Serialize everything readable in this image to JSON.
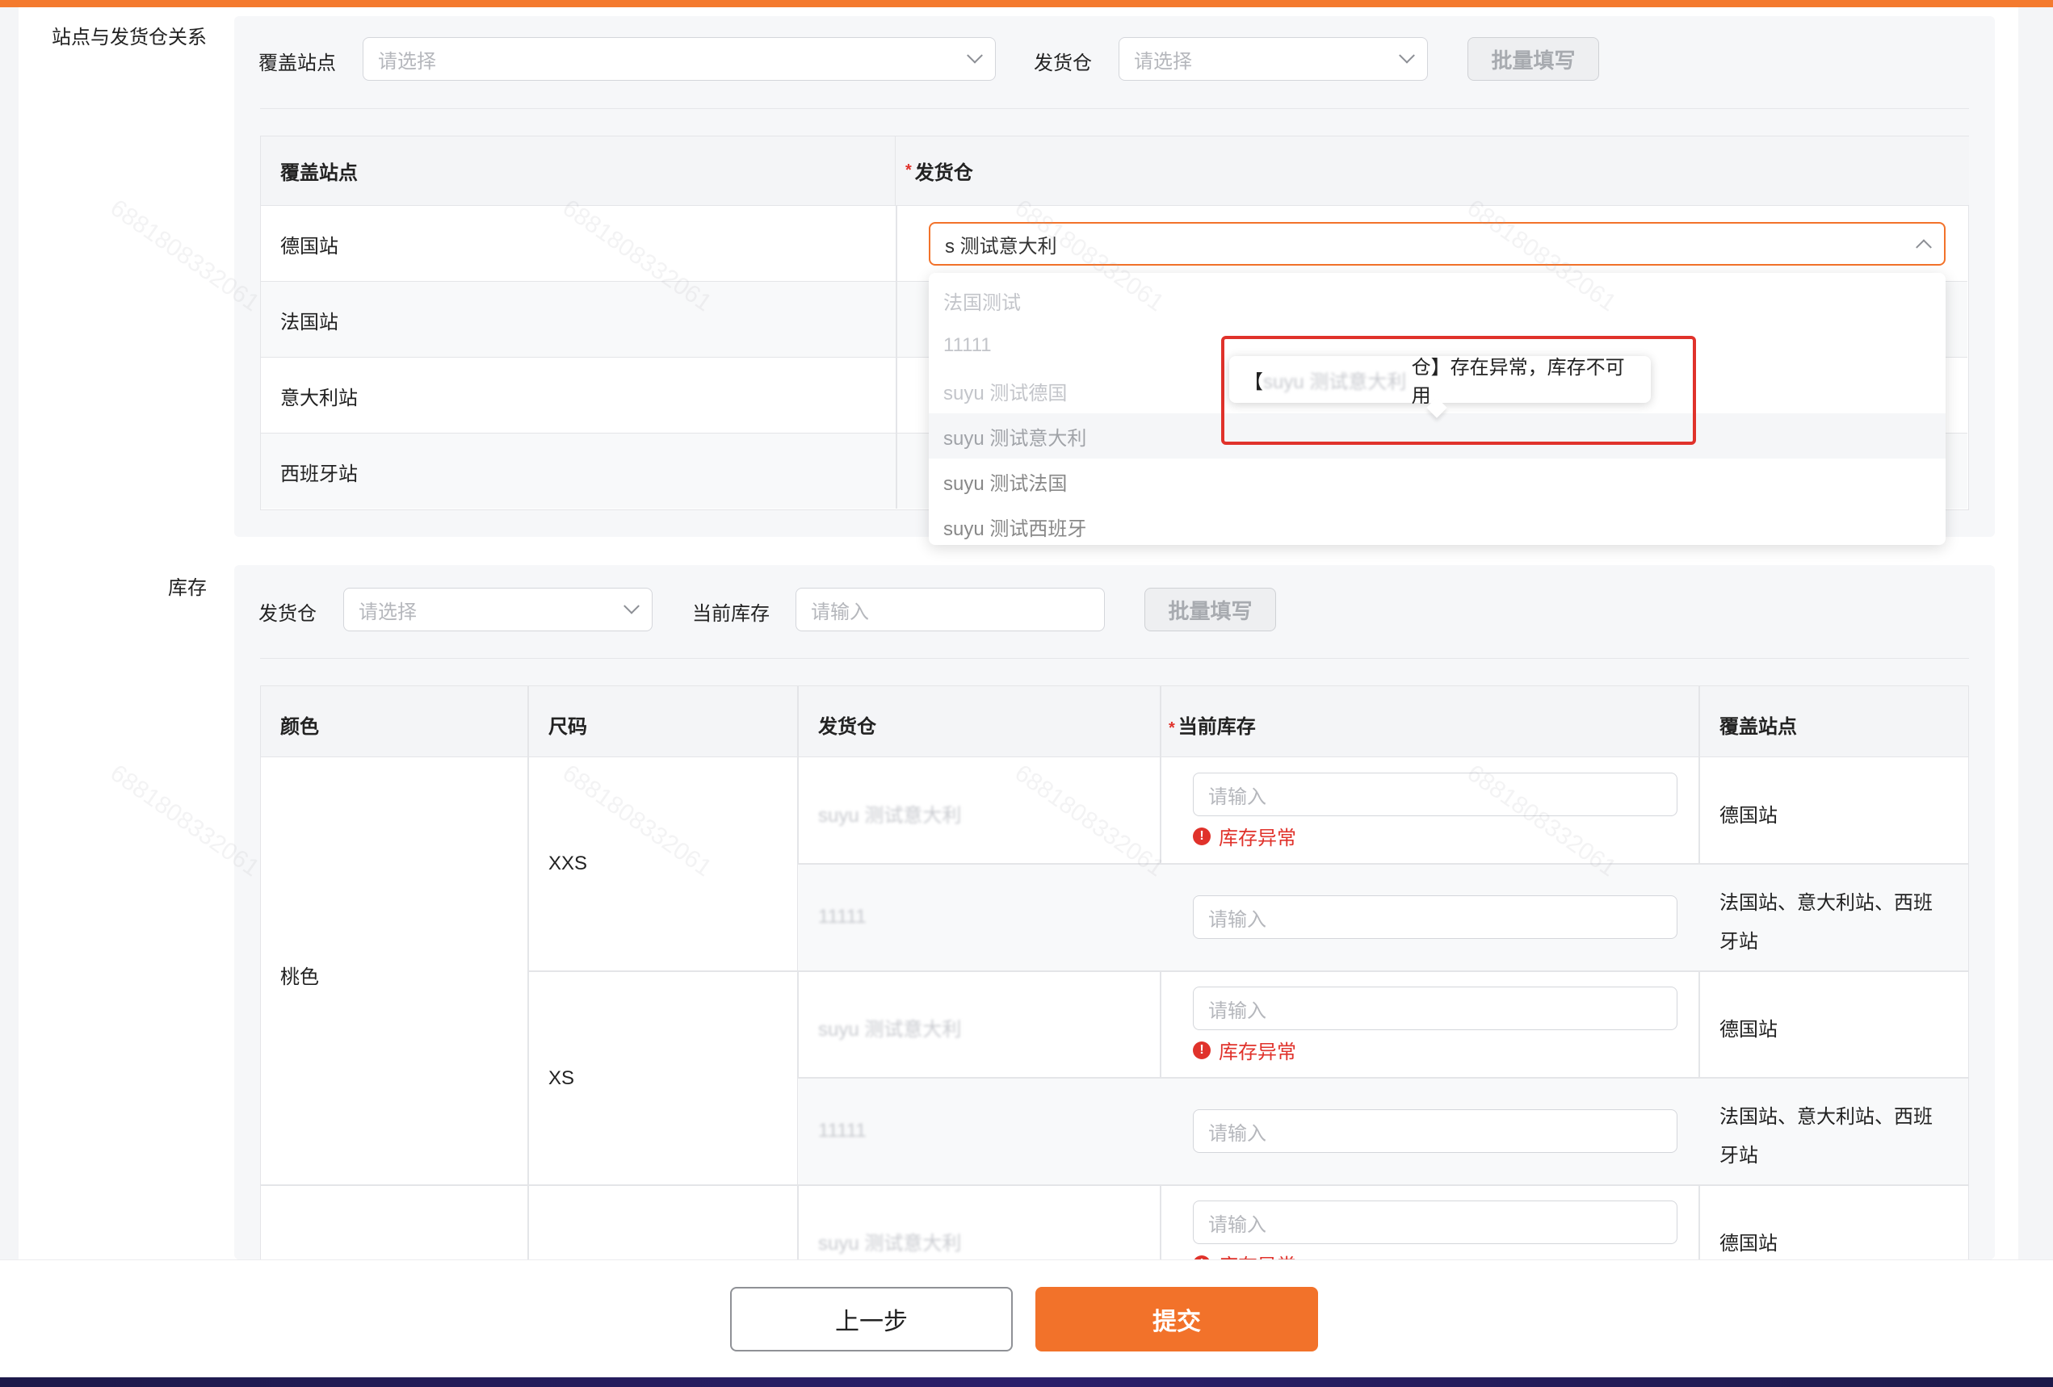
{
  "section1": {
    "label": "站点与发货仓关系",
    "filter": {
      "site_label": "覆盖站点",
      "site_placeholder": "请选择",
      "warehouse_label": "发货仓",
      "warehouse_placeholder": "请选择",
      "batch_button": "批量填写"
    },
    "table": {
      "col_site": "覆盖站点",
      "col_warehouse_required": "*",
      "col_warehouse": "发货仓",
      "rows": [
        {
          "site": "德国站",
          "warehouse": "s   测试意大利"
        },
        {
          "site": "法国站"
        },
        {
          "site": "意大利站"
        },
        {
          "site": "西班牙站"
        }
      ]
    },
    "dropdown": {
      "items": [
        "法国测试",
        "11111",
        "suyu 测试德国",
        "suyu 测试意大利",
        "suyu 测试法国",
        "suyu 测试西班牙"
      ]
    },
    "tooltip": {
      "bracket_open": "【",
      "hidden_name": "suyu 测试意大利",
      "text": "仓】存在异常，库存不可用"
    }
  },
  "section2": {
    "label": "库存",
    "filter": {
      "warehouse_label": "发货仓",
      "warehouse_placeholder": "请选择",
      "stock_label": "当前库存",
      "stock_placeholder": "请输入",
      "batch_button": "批量填写"
    },
    "table": {
      "col_color": "颜色",
      "col_size": "尺码",
      "col_warehouse": "发货仓",
      "col_stock_required": "*",
      "col_stock": "当前库存",
      "col_sites": "覆盖站点",
      "color": "桃色",
      "sizes": [
        "XXS",
        "XS"
      ],
      "rows": [
        {
          "warehouse": "suyu 测试意大利",
          "stock_placeholder": "请输入",
          "error": "库存异常",
          "sites": "德国站"
        },
        {
          "warehouse": "11111",
          "stock_placeholder": "请输入",
          "sites_line1": "法国站、意大利站、西班",
          "sites_line2": "牙站"
        },
        {
          "warehouse": "suyu 测试意大利",
          "stock_placeholder": "请输入",
          "error": "库存异常",
          "sites": "德国站"
        },
        {
          "warehouse": "11111",
          "stock_placeholder": "请输入",
          "sites_line1": "法国站、意大利站、西班",
          "sites_line2": "牙站"
        },
        {
          "warehouse": "suyu 测试意大利",
          "stock_placeholder": "请输入",
          "error": "库存异常",
          "sites": "德国站"
        }
      ]
    }
  },
  "footer": {
    "prev_button": "上一步",
    "submit_button": "提交"
  },
  "watermark": "6881808332061",
  "colors": {
    "accent": "#f2722a",
    "error": "#e0322b",
    "topbar": "#f47a2e"
  }
}
